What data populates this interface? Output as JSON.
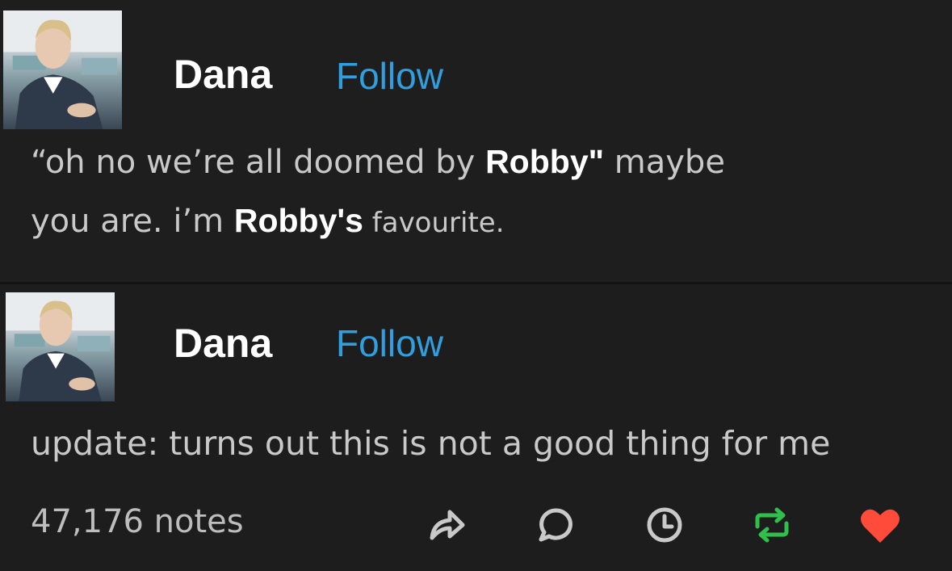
{
  "post1": {
    "username": "Dana",
    "follow_label": "Follow",
    "line1_a": "“oh no we’re all doomed by ",
    "line1_mention": "Robby\"",
    "line1_b": "  maybe",
    "line2_a": "you are. i’m ",
    "line2_mention": "Robby's",
    "line2_b": " favourite."
  },
  "post2": {
    "username": "Dana",
    "follow_label": "Follow",
    "text": "update: turns out this is not a good thing for me"
  },
  "footer": {
    "notes": "47,176 notes",
    "icons": [
      "share-icon",
      "reply-icon",
      "history-icon",
      "reblog-icon",
      "like-icon"
    ],
    "colors": {
      "reblog": "#2fbf4a",
      "like": "#ff4b3a",
      "icon": "#c9c9c9"
    }
  },
  "colors": {
    "background": "#1e1e1e",
    "follow": "#2f9fe0",
    "text": "#c9c9c9"
  }
}
